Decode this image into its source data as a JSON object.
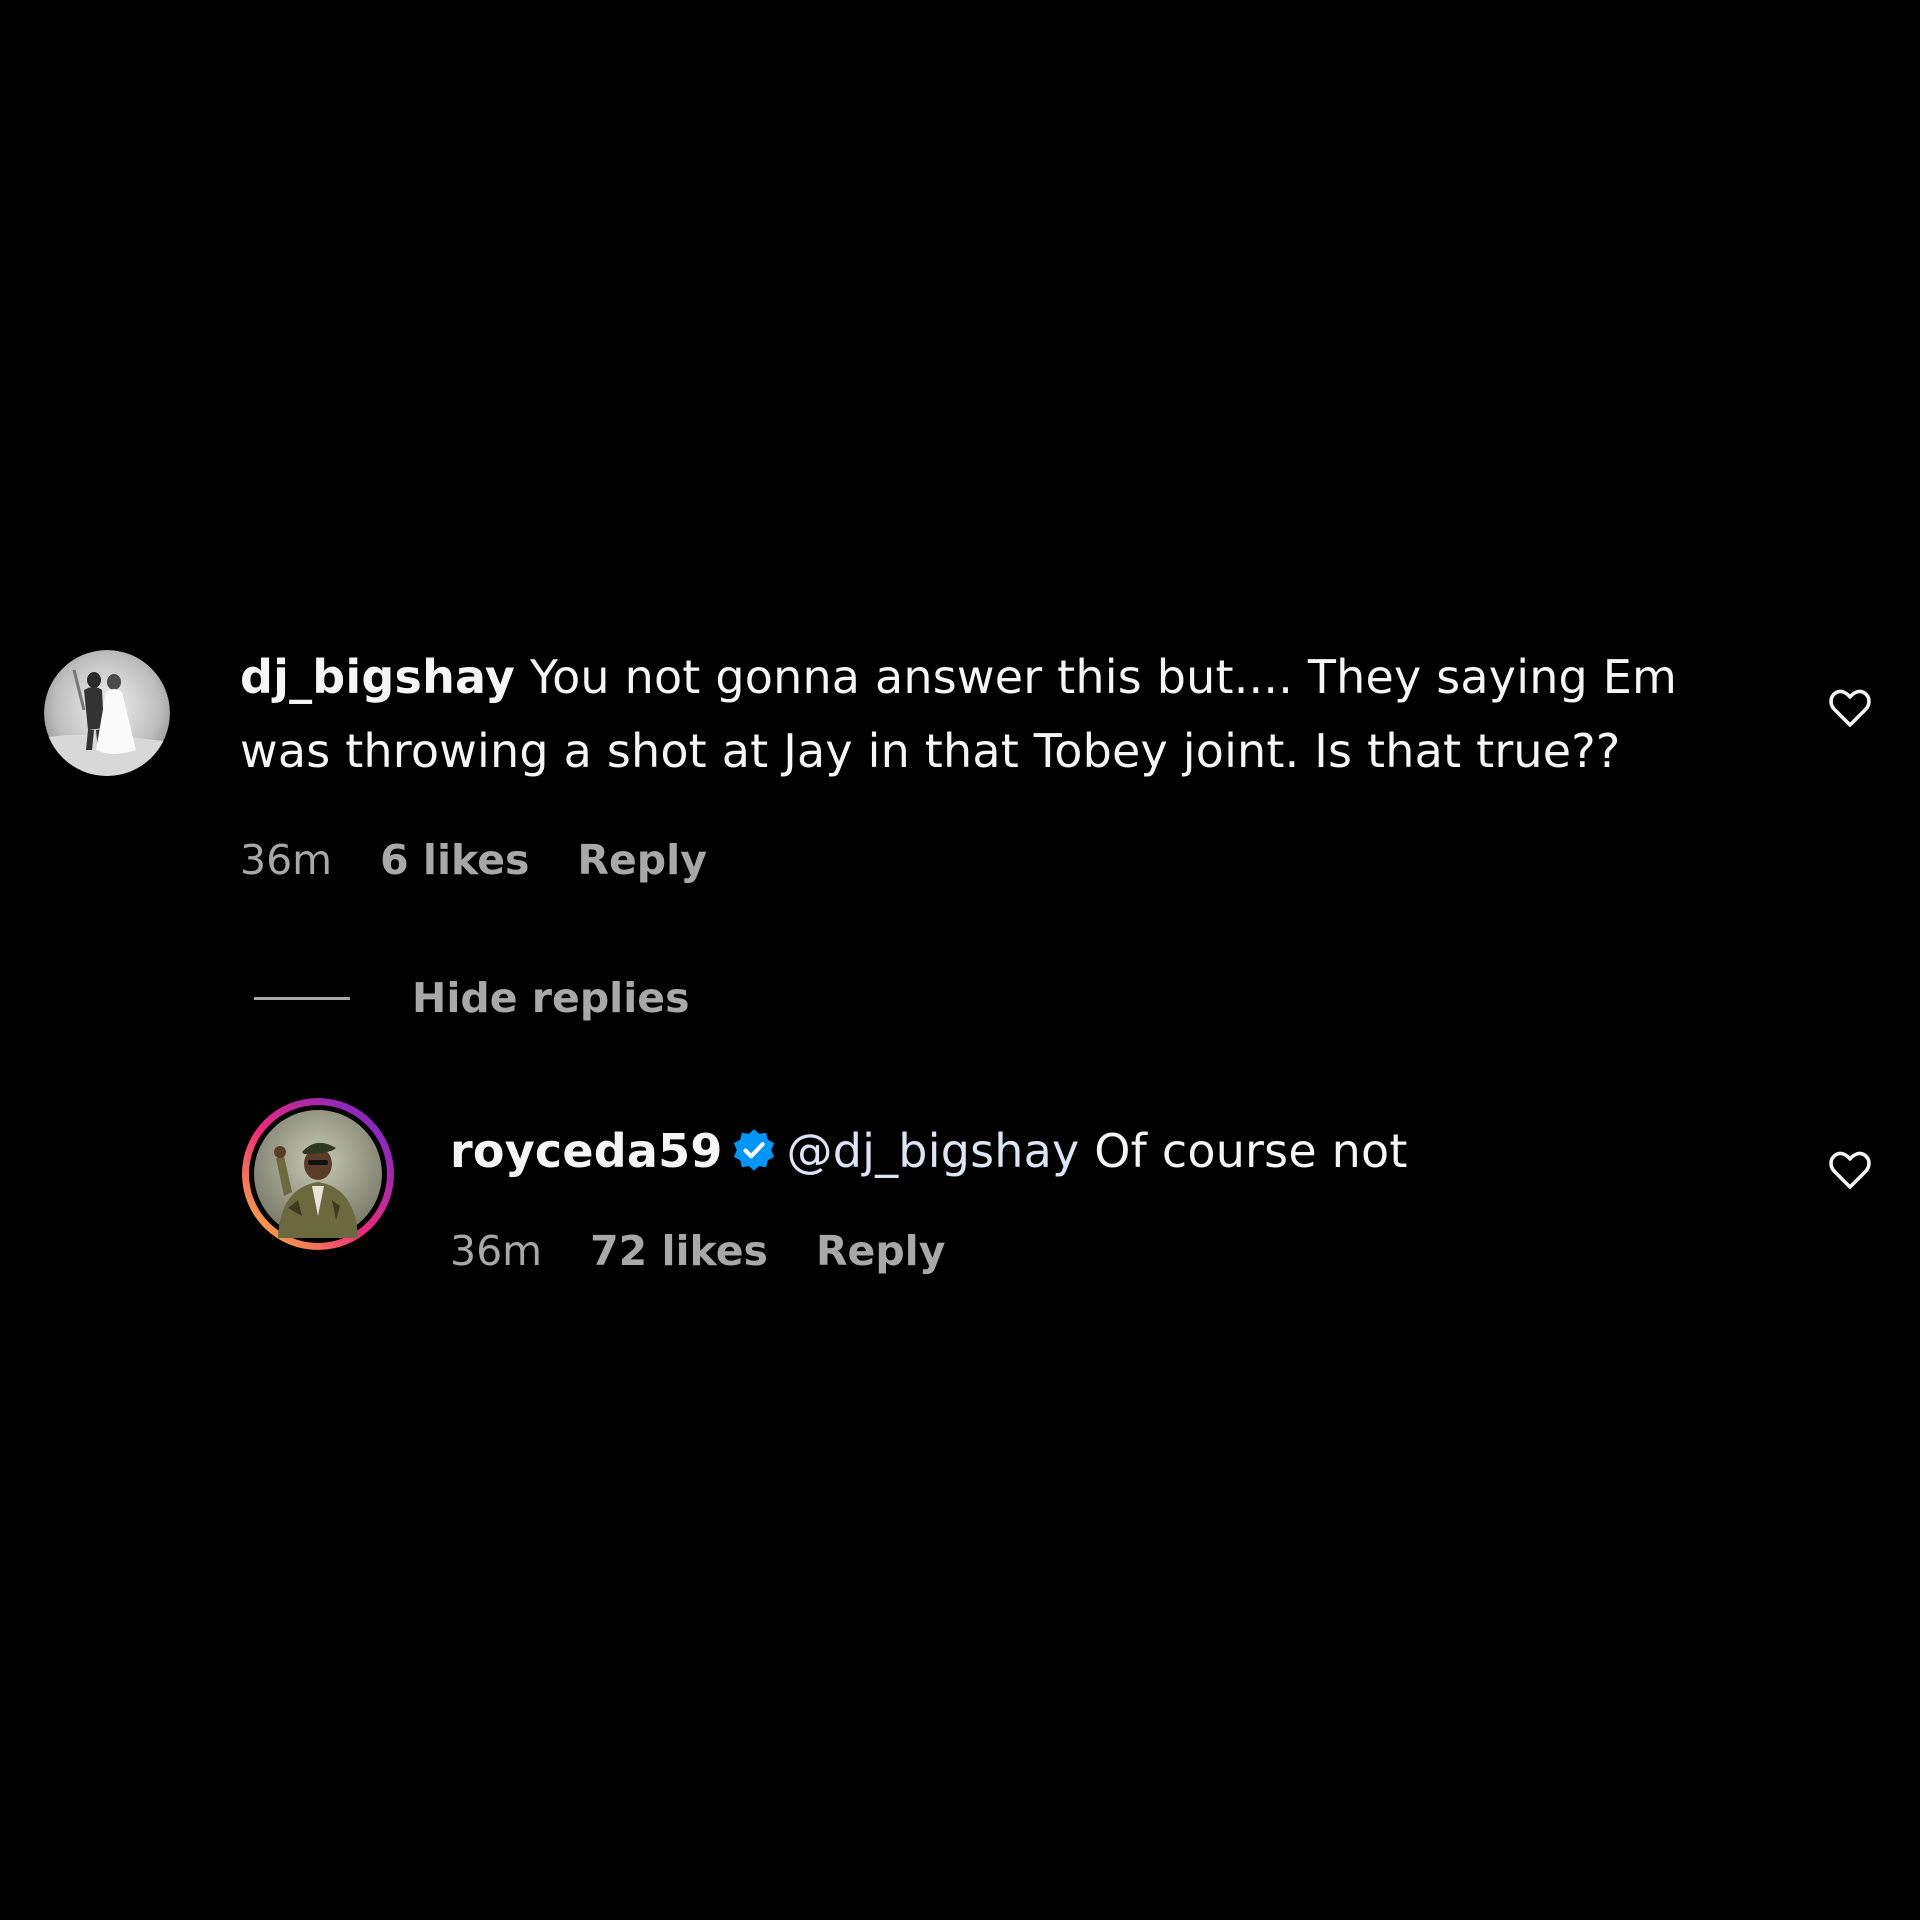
{
  "comments": [
    {
      "username": "dj_bigshay",
      "text": "You not gonna answer this but.... They saying Em was throwing a shot at Jay in that Tobey joint. Is that true??",
      "time": "36m",
      "likes": "6 likes",
      "reply_label": "Reply",
      "avatar_icon": "bw-photo-avatar",
      "like_icon": "heart-outline-icon"
    }
  ],
  "hide_replies_label": "Hide replies",
  "replies": [
    {
      "username": "royceda59",
      "verified": true,
      "mention": "@dj_bigshay",
      "text": "Of course not",
      "time": "36m",
      "likes": "72 likes",
      "reply_label": "Reply",
      "avatar_icon": "story-ring-avatar",
      "like_icon": "heart-outline-icon"
    }
  ],
  "colors": {
    "background": "#000000",
    "text_primary": "#f5f5f5",
    "text_secondary": "#a8a8a8",
    "verified_blue": "#0095f6",
    "story_ring_start": "#f9ce34",
    "story_ring_mid": "#ee2a7b",
    "story_ring_end": "#6228d7"
  }
}
